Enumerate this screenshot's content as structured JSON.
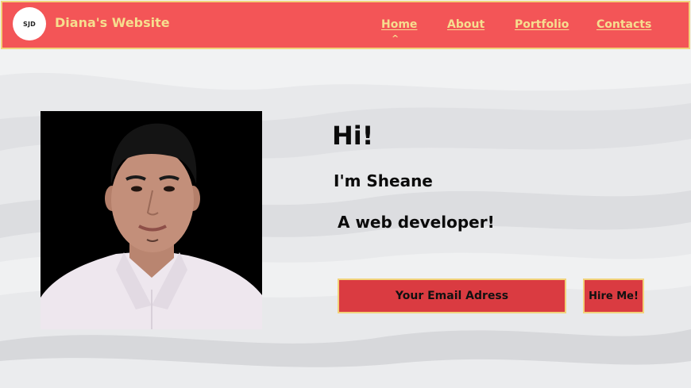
{
  "header": {
    "logo_text": "SJD",
    "site_title": "Diana's Website",
    "nav": [
      {
        "label": "Home",
        "active": true
      },
      {
        "label": "About"
      },
      {
        "label": "Portfolio"
      },
      {
        "label": "Contacts"
      }
    ],
    "active_indicator": "^"
  },
  "hero": {
    "greeting": "Hi!",
    "name_line": "I'm Sheane",
    "role_line": "A web developer!",
    "email_placeholder": "Your Email Adress",
    "hire_label": "Hire Me!"
  },
  "colors": {
    "navbar": "#f35557",
    "accent_gold": "#f6de8f",
    "button": "#da3b41",
    "background": "#e9eaec"
  }
}
